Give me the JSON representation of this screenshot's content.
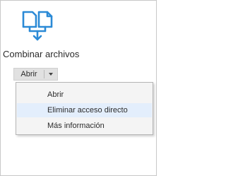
{
  "tool": {
    "title": "Combinar archivos",
    "icon": "combine-files-icon",
    "accent_color": "#2b8ad6"
  },
  "split_button": {
    "label": "Abrir",
    "arrow_icon": "chevron-down-icon"
  },
  "menu": {
    "items": [
      {
        "label": "Abrir",
        "highlighted": false
      },
      {
        "label": "Eliminar acceso directo",
        "highlighted": true
      },
      {
        "label": "Más información",
        "highlighted": false
      }
    ],
    "highlight_color": "#e3eefc"
  }
}
